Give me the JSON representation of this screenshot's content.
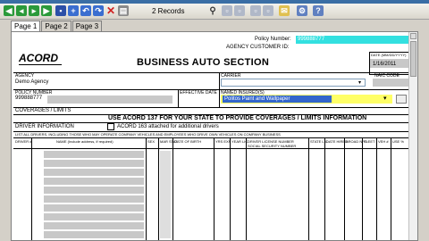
{
  "toolbar": {
    "record_count": "2 Records",
    "icons": [
      "first-icon",
      "prev-icon",
      "next-icon",
      "last-icon",
      "save-icon",
      "new-icon",
      "undo-icon",
      "delete-icon",
      "print-icon",
      "search-icon",
      "zoom-icon",
      "copy-icon",
      "paste-icon",
      "mail-icon",
      "settings-icon",
      "help-icon"
    ]
  },
  "tabs": [
    "Page 1",
    "Page 2",
    "Page 3"
  ],
  "form": {
    "logo": "ACORD",
    "policy_number_label": "Policy Number:",
    "policy_number_value": "999888777",
    "agency_customer_id_label": "AGENCY CUSTOMER ID:",
    "date_label": "DATE (MM/DD/YYYY)",
    "date_value": "1/16/2011",
    "title": "BUSINESS AUTO SECTION",
    "agency_label": "AGENCY",
    "agency_value": "Demo Agency",
    "carrier_label": "CARRIER",
    "naic_label": "NAIC CODE",
    "policy_number_box_label": "POLICY NUMBER",
    "policy_number_box_value": "999888777",
    "effective_date_label": "EFFECTIVE DATE",
    "named_insured_label": "NAMED INSURED(S)",
    "named_insured_value": "Politos Paint and Wallpaper",
    "coverages_header": "COVERAGES / LIMITS",
    "coverages_instruction": "USE ACORD 137 FOR YOUR STATE TO PROVIDE COVERAGES / LIMITS INFORMATION",
    "driver_info_header": "DRIVER  INFORMATION",
    "acord_163_label": "ACORD 163 attached for additional drivers",
    "driver_list_instruction": "LIST ALL DRIVERS, INCLUDING THOSE WHO MAY OPERATE COMPANY VEHICLES AND EMPLOYEES WHO DRIVE OWN VEHICLES ON COMPANY BUSINESS",
    "columns": {
      "driver": "DRIVER #",
      "name": "NAME (Include address, if required)",
      "sex": "SEX",
      "marital": "MAR STAT",
      "dob": "DATE OF BIRTH",
      "yrs_exp": "YRS EXP",
      "year_lic": "YEAR LIC",
      "license_num": "DRIVER LICENSE NUMBER SOCIAL SECURITY NUMBER",
      "state_lic": "STATE LIC",
      "date_hired": "DATE HIRED",
      "broad_nfo": "BROAD NFO",
      "fleet": "FLEET",
      "veh_num": "VEH #",
      "use_pct": "USE %"
    }
  }
}
